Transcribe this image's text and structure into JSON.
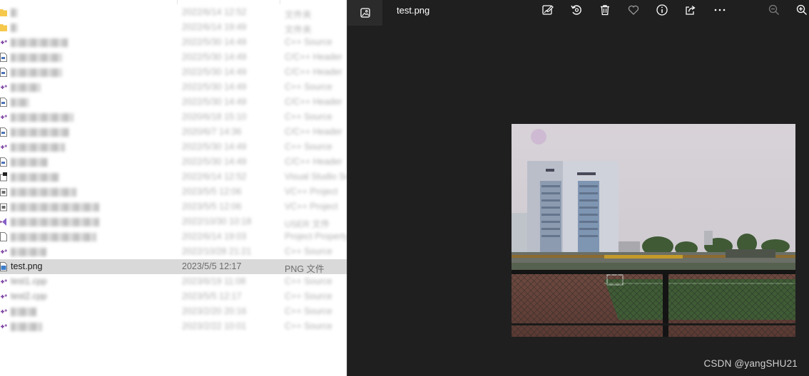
{
  "explorer": {
    "rows": [
      {
        "name": "",
        "date": "2022/6/14 12:52",
        "type": "文件夹",
        "icon": "folder-icon",
        "blurred": true
      },
      {
        "name": "",
        "date": "2022/6/14 19:49",
        "type": "文件夹",
        "icon": "folder-icon",
        "blurred": true
      },
      {
        "name": "",
        "date": "2022/5/30 14:49",
        "type": "C++ Source",
        "icon": "cpp-source-icon",
        "blurred": true
      },
      {
        "name": "",
        "date": "2022/5/30 14:49",
        "type": "C/C++ Header",
        "icon": "header-file-icon",
        "blurred": true
      },
      {
        "name": "",
        "date": "2022/5/30 14:49",
        "type": "C/C++ Header",
        "icon": "header-file-icon",
        "blurred": true
      },
      {
        "name": "",
        "date": "2022/5/30 14:49",
        "type": "C++ Source",
        "icon": "cpp-source-icon",
        "blurred": true
      },
      {
        "name": "",
        "date": "2022/5/30 14:49",
        "type": "C/C++ Header",
        "icon": "header-file-icon",
        "blurred": true
      },
      {
        "name": "",
        "date": "2020/6/18 15:10",
        "type": "C++ Source",
        "icon": "cpp-source-icon",
        "blurred": true
      },
      {
        "name": "",
        "date": "2020/6/7 14:36",
        "type": "C/C++ Header",
        "icon": "header-file-icon",
        "blurred": true
      },
      {
        "name": "",
        "date": "2022/5/30 14:49",
        "type": "C++ Source",
        "icon": "cpp-source-icon",
        "blurred": true
      },
      {
        "name": "",
        "date": "2022/5/30 14:49",
        "type": "C/C++ Header",
        "icon": "header-file-icon",
        "blurred": true
      },
      {
        "name": "",
        "date": "2022/6/14 12:52",
        "type": "Visual Studio Solution",
        "icon": "solution-file-icon",
        "blurred": true
      },
      {
        "name": "",
        "date": "2023/5/5 12:06",
        "type": "VC++ Project",
        "icon": "vcxproj-icon",
        "blurred": true
      },
      {
        "name": "",
        "date": "2023/5/5 12:06",
        "type": "VC++ Project",
        "icon": "vcxproj-icon",
        "blurred": true
      },
      {
        "name": "",
        "date": "2022/10/30 10:18",
        "type": "USER 文件",
        "icon": "visual-studio-icon",
        "blurred": true
      },
      {
        "name": "",
        "date": "2022/6/14 19:03",
        "type": "Project Property",
        "icon": "property-file-icon",
        "blurred": true
      },
      {
        "name": "",
        "date": "2022/10/28 21:21",
        "type": "C++ Source",
        "icon": "cpp-source-icon",
        "blurred": true
      },
      {
        "name": "test.png",
        "date": "2023/5/5 12:17",
        "type": "PNG 文件",
        "icon": "png-file-icon",
        "blurred": false,
        "selected": true
      },
      {
        "name": "test1.cpp",
        "date": "2023/6/19 11:08",
        "type": "C++ Source",
        "icon": "cpp-source-icon",
        "blurred": true
      },
      {
        "name": "test2.cpp",
        "date": "2023/5/5 12:17",
        "type": "C++ Source",
        "icon": "cpp-source-icon",
        "blurred": true
      },
      {
        "name": "",
        "date": "2023/2/20 20:16",
        "type": "C++ Source",
        "icon": "cpp-source-icon",
        "blurred": true
      },
      {
        "name": "",
        "date": "2023/2/22 10:01",
        "type": "C++ Source",
        "icon": "cpp-source-icon",
        "blurred": true
      }
    ]
  },
  "viewer": {
    "title": "test.png",
    "toolbar": [
      "edit-image-icon",
      "rotate-icon",
      "delete-icon",
      "favorite-heart-icon",
      "info-icon",
      "share-icon",
      "more-options-icon",
      "zoom-out-icon",
      "zoom-in-icon"
    ],
    "watermark": "CSDN @yangSHU21"
  },
  "colors": {
    "viewer_bg": "#1f1f1f",
    "selection": "#d9d9d9",
    "cpp_icon": "#7a3fa0"
  }
}
